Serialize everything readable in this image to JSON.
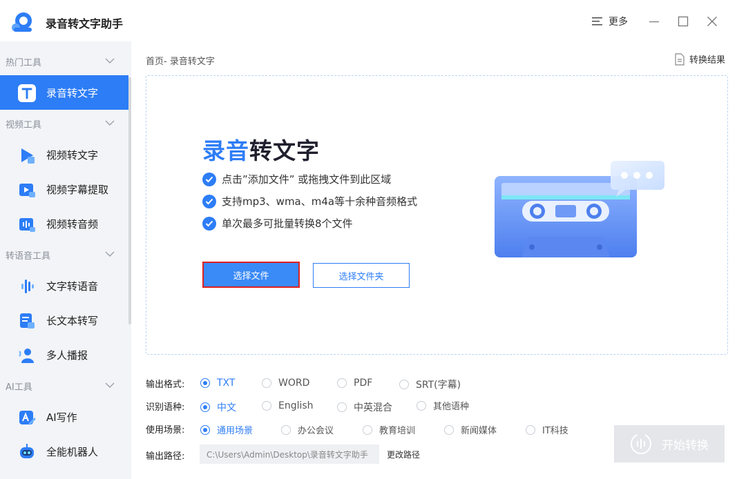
{
  "app": {
    "title": "录音转文字助手"
  },
  "titlebar": {
    "more_label": "更多"
  },
  "sidebar": {
    "groups": [
      {
        "label": "热门工具",
        "items": [
          {
            "label": "录音转文字",
            "active": true
          }
        ]
      },
      {
        "label": "视频工具",
        "items": [
          {
            "label": "视频转文字"
          },
          {
            "label": "视频字幕提取"
          },
          {
            "label": "视频转音频"
          }
        ]
      },
      {
        "label": "转语音工具",
        "items": [
          {
            "label": "文字转语音"
          },
          {
            "label": "长文本转写"
          },
          {
            "label": "多人播报"
          }
        ]
      },
      {
        "label": "AI工具",
        "items": [
          {
            "label": "AI写作"
          },
          {
            "label": "全能机器人"
          }
        ]
      }
    ]
  },
  "main": {
    "breadcrumb": "首页- 录音转文字",
    "result_link": "转换结果",
    "hero": {
      "title_accent": "录音",
      "title_rest": "转文字"
    },
    "features": [
      "点击”添加文件” 或拖拽文件到此区域",
      "支持mp3、wma、m4a等十余种音频格式",
      "单次最多可批量转换8个文件"
    ],
    "buttons": {
      "select_file": "选择文件",
      "select_folder": "选择文件夹"
    }
  },
  "options": {
    "format": {
      "label": "输出格式:",
      "options": [
        "TXT",
        "WORD",
        "PDF",
        "SRT(字幕)"
      ],
      "selected": "TXT"
    },
    "language": {
      "label": "识别语种:",
      "options": [
        "中文",
        "English",
        "中英混合",
        "其他语种"
      ],
      "selected": "中文"
    },
    "scene": {
      "label": "使用场景:",
      "options": [
        "通用场景",
        "办公会议",
        "教育培训",
        "新闻媒体",
        "IT科技"
      ],
      "selected": "通用场景"
    },
    "path": {
      "label": "输出路径:",
      "value": "C:\\Users\\Admin\\Desktop\\录音转文字助手",
      "change_label": "更改路径"
    }
  },
  "start_button": "开始转换",
  "colors": {
    "accent": "#2d7df6",
    "highlight_border": "#e02020",
    "sidebar_bg": "#f2f4f7"
  }
}
